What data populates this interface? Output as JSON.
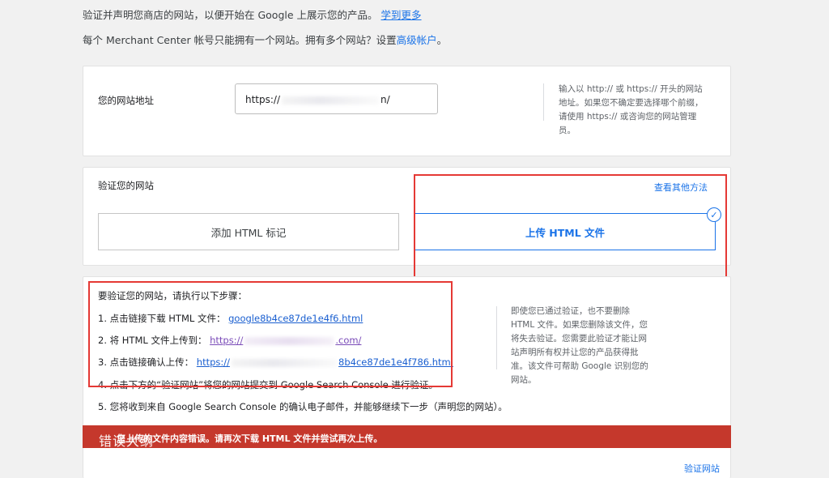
{
  "intro": {
    "line1_text": "验证并声明您商店的网站，以便开始在 Google 上展示您的产品。",
    "line1_link": "学到更多",
    "line2_text": "每个 Merchant Center 帐号只能拥有一个网站。拥有多个网站？设置",
    "line2_link": "高级帐户",
    "line2_end": "。"
  },
  "website": {
    "label": "您的网站地址",
    "value_prefix": "https://",
    "value_suffix": "n/",
    "hint": "输入以 http:// 或 https:// 开头的网站地址。如果您不确定要选择哪个前缀，请使用 https:// 或咨询您的网站管理员。"
  },
  "verify": {
    "label": "验证您的网站",
    "other_methods": "查看其他方法",
    "methods": [
      {
        "label": "添加 HTML 标记",
        "selected": false
      },
      {
        "label": "上传 HTML 文件",
        "selected": true
      }
    ],
    "check_icon": "check-circle-icon"
  },
  "steps": {
    "title": "要验证您的网站，请执行以下步骤：",
    "s1_text": "1. 点击链接下载 HTML 文件：",
    "s1_link_prefix": "google",
    "s1_link_mid": "8b4ce87de1e4f",
    "s1_link_suffix": "6.html",
    "s2_text": "2. 将 HTML 文件上传到：",
    "s2_link_prefix": "https://",
    "s2_link_suffix": ".com/",
    "s3_text": "3. 点击链接确认上传：",
    "s3_link_prefix": "https://",
    "s3_link_suffix": "8b4ce87de1e4f786.html",
    "s4_text": "4. 点击下方的“验证网站”将您的网站提交到 Google Search Console 进行验证。",
    "s5_text": "5. 您将收到来自 Google Search Console 的确认电子邮件，并能够继续下一步（声明您的网站）。",
    "note": "即使您已通过验证，也不要删除 HTML 文件。如果您删除该文件，您将失去验证。您需要此验证才能让网站声明所有权并让您的产品获得批准。该文件可帮助 Google 识别您的网站。"
  },
  "error": {
    "overlay": "错误大纲",
    "message": "您上传的文件内容错误。请再次下载 HTML 文件并尝试再次上传。",
    "color": "#c5382c"
  },
  "footer": {
    "verify_link": "验证网站"
  }
}
